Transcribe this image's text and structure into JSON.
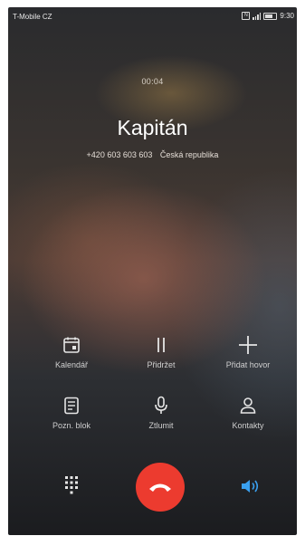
{
  "status_bar": {
    "carrier": "T-Mobile CZ",
    "time": "9:30"
  },
  "call": {
    "duration": "00:04",
    "contact_name": "Kapitán",
    "number": "+420 603 603 603",
    "location": "Česká republika"
  },
  "actions": {
    "calendar": "Kalendář",
    "hold": "Přidržet",
    "add_call": "Přidat hovor",
    "notepad": "Pozn. blok",
    "mute": "Ztlumit",
    "contacts": "Kontakty"
  },
  "colors": {
    "end_call": "#ec3b2f",
    "speaker_active": "#3aa0f0"
  },
  "icons": {
    "dialpad": "dialpad-icon",
    "end": "end-call-icon",
    "speaker": "speaker-icon"
  }
}
